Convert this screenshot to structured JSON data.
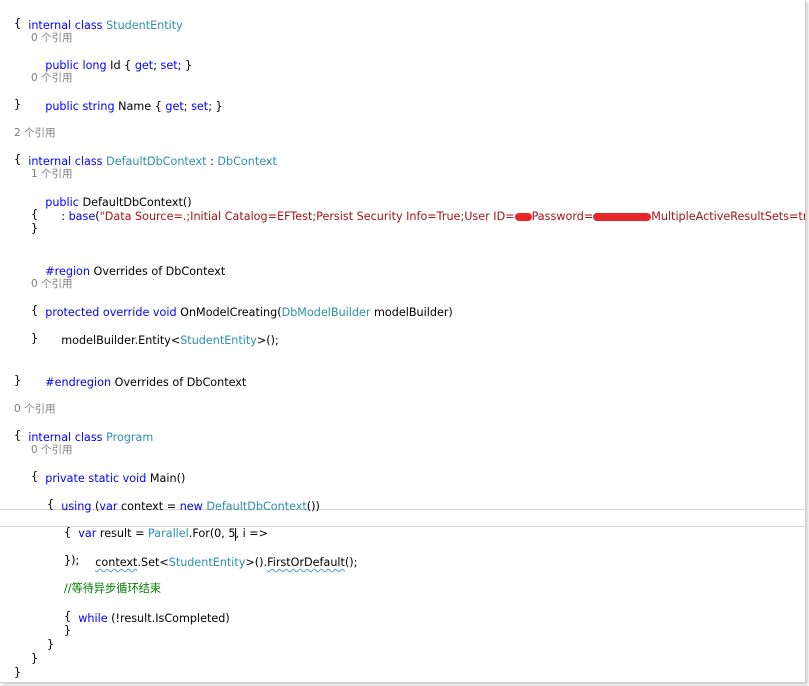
{
  "code": {
    "l_student_class": [
      "internal",
      " ",
      "class",
      " ",
      "StudentEntity"
    ],
    "l_brace_open": "{",
    "l_brace_close": "}",
    "refs_0": "0 个引用",
    "refs_1": "1 个引用",
    "refs_2": "2 个引用",
    "l_id_prop": [
      "public",
      " ",
      "long",
      " Id { ",
      "get",
      "; ",
      "set",
      "; }"
    ],
    "l_name_prop": [
      "public",
      " ",
      "string",
      " Name { ",
      "get",
      "; ",
      "set",
      "; }"
    ],
    "l_ctx_class": [
      "internal",
      " ",
      "class",
      " ",
      "DefaultDbContext",
      " : ",
      "DbContext"
    ],
    "l_ctor": [
      "public",
      " DefaultDbContext()"
    ],
    "l_base_prefix": ": ",
    "l_base_kw": "base",
    "l_base_open": "(",
    "l_conn_part1": "\"Data Source=.;Initial Catalog=EFTest;Persist Security Info=True;User ID=",
    "l_conn_part2": "Password=",
    "l_conn_part3": "MultipleActiveResultSets=true\"",
    "l_base_close": ")",
    "l_region": [
      "#region",
      " Overrides of DbContext"
    ],
    "l_onmodel": [
      "protected",
      " ",
      "override",
      " ",
      "void",
      " OnModelCreating(",
      "DbModelBuilder",
      " modelBuilder)"
    ],
    "l_entity": [
      "modelBuilder.Entity<",
      "StudentEntity",
      ">();"
    ],
    "l_endregion": [
      "#endregion",
      " Overrides of DbContext"
    ],
    "l_program_class": [
      "internal",
      " ",
      "class",
      " ",
      "Program"
    ],
    "l_main": [
      "private",
      " ",
      "static",
      " ",
      "void",
      " Main()"
    ],
    "l_using": [
      "using",
      " (",
      "var",
      " context = ",
      "new",
      " ",
      "DefaultDbContext",
      "())"
    ],
    "l_var_result_a": [
      "var",
      " result = ",
      "Parallel",
      ".For(0, 5"
    ],
    "l_var_result_b": ", i =>",
    "l_context_set": [
      "context",
      ".Set<",
      "StudentEntity",
      ">().",
      "FirstOrDefault",
      "();"
    ],
    "l_close_lambda": "});",
    "l_comment": "//等待异步循环结束",
    "l_while": [
      "while",
      " (!result.IsCompleted)"
    ]
  },
  "colors": {
    "keyword": "#0000ff",
    "type": "#2b91af",
    "string": "#a31515",
    "comment": "#008000",
    "codelens": "#808080",
    "redaction": "#e8262a"
  }
}
